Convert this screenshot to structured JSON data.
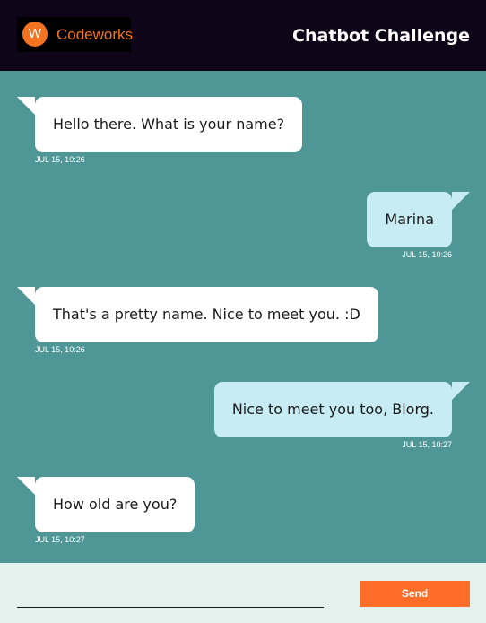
{
  "header": {
    "logo_letter": "W",
    "logo_text": "Codeworks",
    "title": "Chatbot Challenge"
  },
  "messages": [
    {
      "sender": "bot",
      "text": "Hello there. What is your name?",
      "time": "JUL 15, 10:26"
    },
    {
      "sender": "user",
      "text": "Marina",
      "time": "JUL 15, 10:26"
    },
    {
      "sender": "bot",
      "text": "That's a pretty name. Nice to meet you. :D",
      "time": "JUL 15, 10:26"
    },
    {
      "sender": "user",
      "text": "Nice to meet you too, Blorg.",
      "time": "JUL 15, 10:27"
    },
    {
      "sender": "bot",
      "text": "How old are you?",
      "time": "JUL 15, 10:27"
    }
  ],
  "composer": {
    "value": "",
    "placeholder": "",
    "send_label": "Send"
  },
  "colors": {
    "header_bg": "#0f0519",
    "chat_bg": "#4f9696",
    "bot_bubble": "#ffffff",
    "user_bubble": "#c7ecf3",
    "accent": "#f47320",
    "send_button": "#ff6d29",
    "footer_bg": "#e4f2ee"
  },
  "icons": {
    "logo": "codeworks-logo-icon"
  }
}
